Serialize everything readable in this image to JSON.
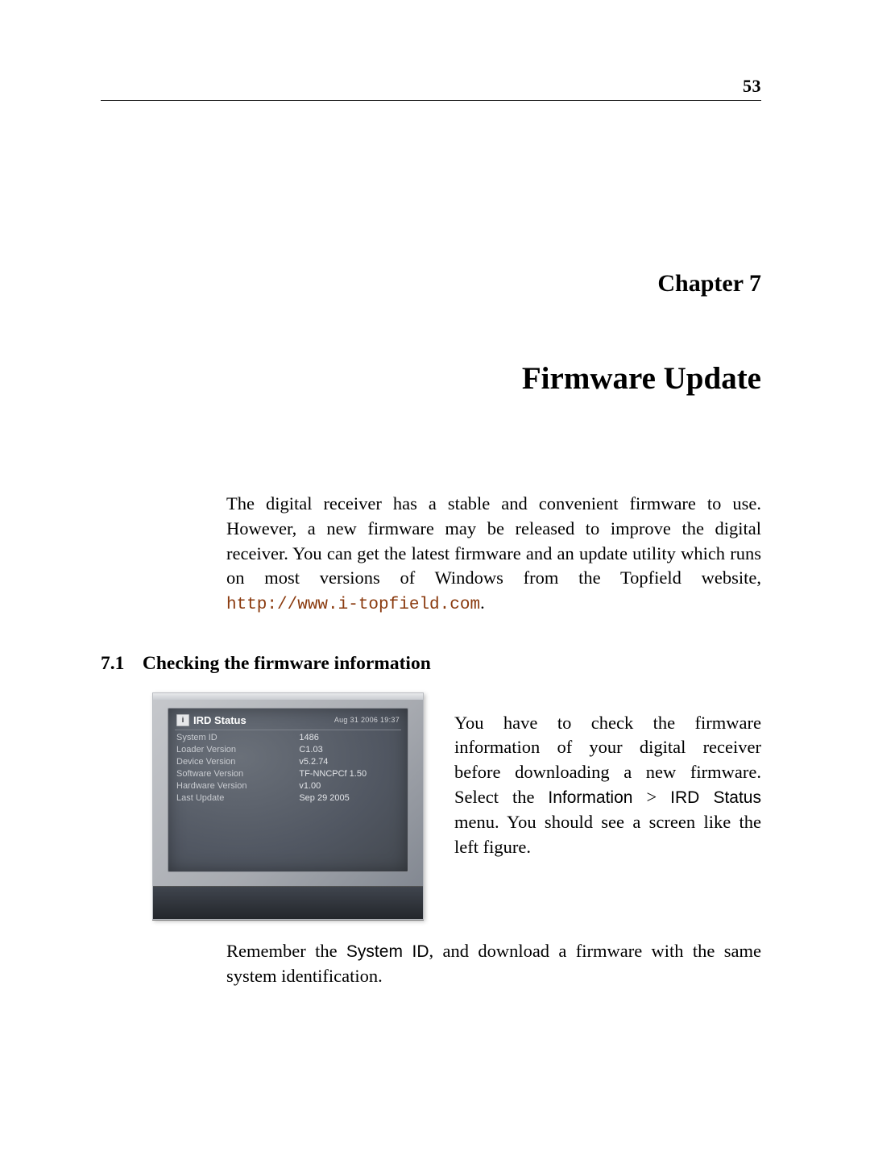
{
  "page_number": "53",
  "chapter_label": "Chapter 7",
  "chapter_title": "Firmware Update",
  "intro_text_a": "The digital receiver has a stable and convenient firmware to use.  However, a new firmware may be released to improve the digital receiver.  You can get the latest firmware and an update utility which runs on most versions of Windows from the Topfield website, ",
  "intro_url": "http://www.i-topfield.com",
  "intro_text_b": ".",
  "section_number": "7.1",
  "section_title": "Checking the firmware information",
  "right_para_a": "You have to check the firmware information of your digital receiver before downloading a new firmware. Select the ",
  "right_para_menu_a": "Information",
  "right_para_gt": ">",
  "right_para_menu_b": "IRD Status",
  "right_para_b": " menu. You should see a screen like the left figure.",
  "after_a": "Remember the ",
  "after_sysid": "System ID",
  "after_b": ", and download a firmware with the same system identification.",
  "figure": {
    "title_icon": "i",
    "title": "IRD Status",
    "timestamp": "Aug 31 2006 19:37",
    "rows": [
      {
        "k": "System ID",
        "v": "1486"
      },
      {
        "k": "Loader Version",
        "v": "C1.03"
      },
      {
        "k": "Device Version",
        "v": "v5.2.74"
      },
      {
        "k": "Software Version",
        "v": "TF-NNCPCf 1.50"
      },
      {
        "k": "Hardware Version",
        "v": "v1.00"
      },
      {
        "k": "Last Update",
        "v": "Sep 29 2005"
      }
    ]
  }
}
